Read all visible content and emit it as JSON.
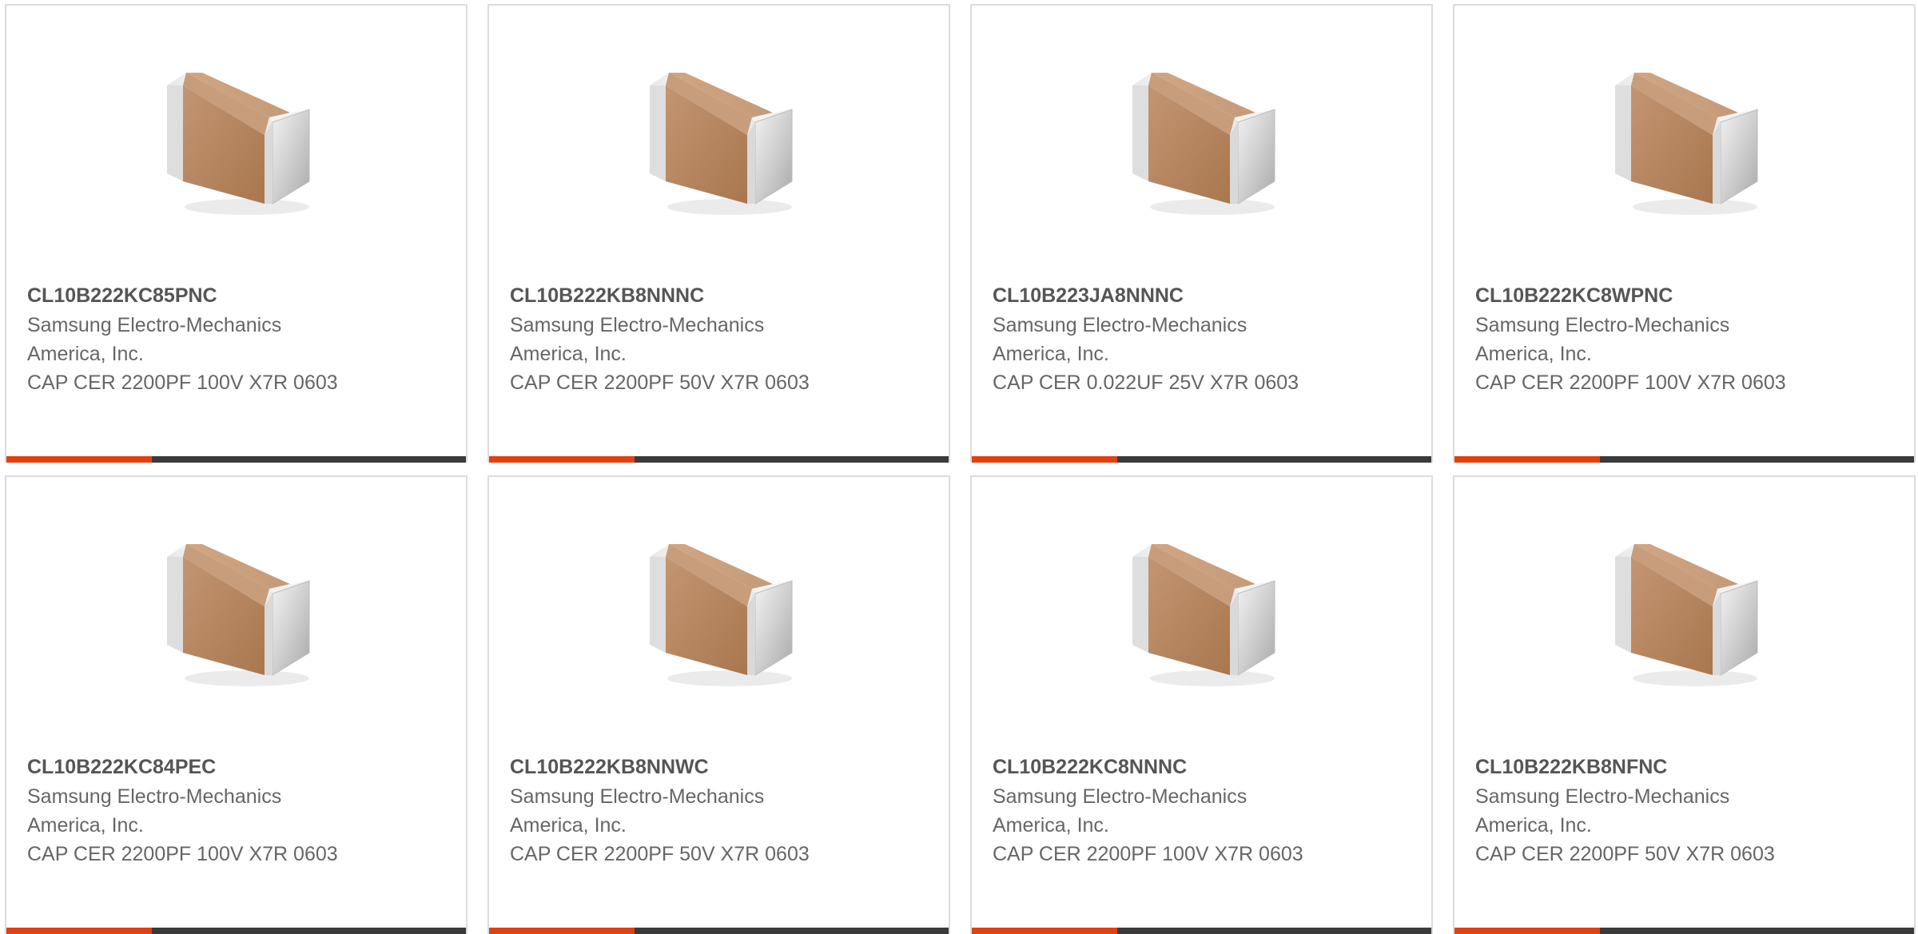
{
  "colors": {
    "accent": "#e2410f",
    "bar": "#3a3a3a",
    "border": "#dcdcdc",
    "part_number_text": "#555555",
    "body_text": "#666666"
  },
  "products": [
    {
      "image_icon": "ceramic-capacitor-image",
      "part_number": "CL10B222KC85PNC",
      "manufacturer": "Samsung Electro-Mechanics America, Inc.",
      "description": "CAP CER 2200PF 100V X7R 0603"
    },
    {
      "image_icon": "ceramic-capacitor-image",
      "part_number": "CL10B222KB8NNNC",
      "manufacturer": "Samsung Electro-Mechanics America, Inc.",
      "description": "CAP CER 2200PF 50V X7R 0603"
    },
    {
      "image_icon": "ceramic-capacitor-image",
      "part_number": "CL10B223JA8NNNC",
      "manufacturer": "Samsung Electro-Mechanics America, Inc.",
      "description": "CAP CER 0.022UF 25V X7R 0603"
    },
    {
      "image_icon": "ceramic-capacitor-image",
      "part_number": "CL10B222KC8WPNC",
      "manufacturer": "Samsung Electro-Mechanics America, Inc.",
      "description": "CAP CER 2200PF 100V X7R 0603"
    },
    {
      "image_icon": "ceramic-capacitor-image",
      "part_number": "CL10B222KC84PEC",
      "manufacturer": "Samsung Electro-Mechanics America, Inc.",
      "description": "CAP CER 2200PF 100V X7R 0603"
    },
    {
      "image_icon": "ceramic-capacitor-image",
      "part_number": "CL10B222KB8NNWC",
      "manufacturer": "Samsung Electro-Mechanics America, Inc.",
      "description": "CAP CER 2200PF 50V X7R 0603"
    },
    {
      "image_icon": "ceramic-capacitor-image",
      "part_number": "CL10B222KC8NNNC",
      "manufacturer": "Samsung Electro-Mechanics America, Inc.",
      "description": "CAP CER 2200PF 100V X7R 0603"
    },
    {
      "image_icon": "ceramic-capacitor-image",
      "part_number": "CL10B222KB8NFNC",
      "manufacturer": "Samsung Electro-Mechanics America, Inc.",
      "description": "CAP CER 2200PF 50V X7R 0603"
    }
  ]
}
